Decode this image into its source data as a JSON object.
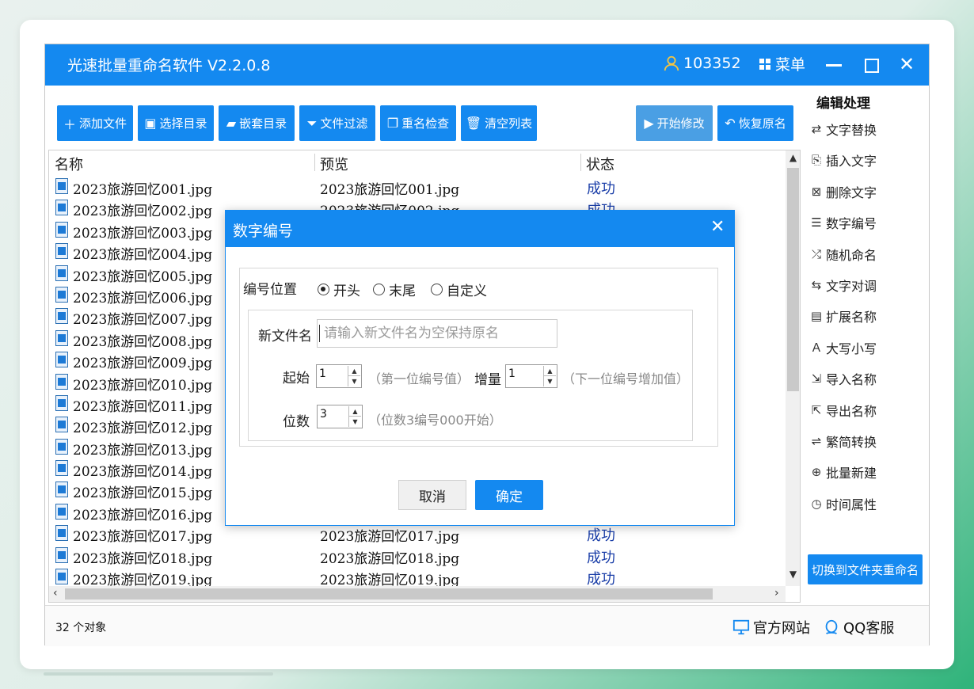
{
  "window": {
    "title": "光速批量重命名软件 V2.2.0.8",
    "user_id": "103352",
    "menu_label": "菜单",
    "close_symbol": "✕"
  },
  "toolbar": {
    "add_file": "添加文件",
    "select_dir": "选择目录",
    "nested_dir": "嵌套目录",
    "file_filter": "文件过滤",
    "rename_check": "重名检查",
    "clear_list": "清空列表",
    "start_modify": "开始修改",
    "restore_name": "恢复原名"
  },
  "list": {
    "headers": {
      "name": "名称",
      "preview": "预览",
      "status": "状态"
    },
    "rows": [
      {
        "name": "2023旅游回忆001.jpg",
        "preview": "2023旅游回忆001.jpg",
        "status": "成功"
      },
      {
        "name": "2023旅游回忆002.jpg",
        "preview": "2023旅游回忆002.jpg",
        "status": "成功"
      },
      {
        "name": "2023旅游回忆003.jpg",
        "preview": "",
        "status": ""
      },
      {
        "name": "2023旅游回忆004.jpg",
        "preview": "",
        "status": ""
      },
      {
        "name": "2023旅游回忆005.jpg",
        "preview": "",
        "status": ""
      },
      {
        "name": "2023旅游回忆006.jpg",
        "preview": "",
        "status": ""
      },
      {
        "name": "2023旅游回忆007.jpg",
        "preview": "",
        "status": ""
      },
      {
        "name": "2023旅游回忆008.jpg",
        "preview": "",
        "status": ""
      },
      {
        "name": "2023旅游回忆009.jpg",
        "preview": "",
        "status": ""
      },
      {
        "name": "2023旅游回忆010.jpg",
        "preview": "",
        "status": ""
      },
      {
        "name": "2023旅游回忆011.jpg",
        "preview": "",
        "status": ""
      },
      {
        "name": "2023旅游回忆012.jpg",
        "preview": "",
        "status": ""
      },
      {
        "name": "2023旅游回忆013.jpg",
        "preview": "",
        "status": ""
      },
      {
        "name": "2023旅游回忆014.jpg",
        "preview": "",
        "status": ""
      },
      {
        "name": "2023旅游回忆015.jpg",
        "preview": "",
        "status": ""
      },
      {
        "name": "2023旅游回忆016.jpg",
        "preview": "",
        "status": ""
      },
      {
        "name": "2023旅游回忆017.jpg",
        "preview": "2023旅游回忆017.jpg",
        "status": "成功"
      },
      {
        "name": "2023旅游回忆018.jpg",
        "preview": "2023旅游回忆018.jpg",
        "status": "成功"
      },
      {
        "name": "2023旅游回忆019.jpg",
        "preview": "2023旅游回忆019.jpg",
        "status": "成功"
      }
    ]
  },
  "sidebar": {
    "title": "编辑处理",
    "items": [
      {
        "label": "文字替换",
        "icon": "swap-arrows-icon",
        "glyph": "⇄"
      },
      {
        "label": "插入文字",
        "icon": "insert-doc-icon",
        "glyph": "⎘"
      },
      {
        "label": "删除文字",
        "icon": "delete-doc-icon",
        "glyph": "⊠"
      },
      {
        "label": "数字编号",
        "icon": "number-list-icon",
        "glyph": "☰"
      },
      {
        "label": "随机命名",
        "icon": "shuffle-icon",
        "glyph": "⤮"
      },
      {
        "label": "文字对调",
        "icon": "exchange-icon",
        "glyph": "⇆"
      },
      {
        "label": "扩展名称",
        "icon": "extension-icon",
        "glyph": "▤"
      },
      {
        "label": "大写小写",
        "icon": "case-icon",
        "glyph": "Ａ"
      },
      {
        "label": "导入名称",
        "icon": "import-icon",
        "glyph": "⇲"
      },
      {
        "label": "导出名称",
        "icon": "export-icon",
        "glyph": "⇱"
      },
      {
        "label": "繁简转换",
        "icon": "convert-icon",
        "glyph": "⇌"
      },
      {
        "label": "批量新建",
        "icon": "new-file-icon",
        "glyph": "⊕"
      },
      {
        "label": "时间属性",
        "icon": "clock-icon",
        "glyph": "◷"
      }
    ],
    "switch_button": "切换到文件夹重命名"
  },
  "status": {
    "count": "32 个对象",
    "website": "官方网站",
    "qq": "QQ客服"
  },
  "dialog": {
    "title": "数字编号",
    "position_label": "编号位置",
    "radio_start": "开头",
    "radio_end": "末尾",
    "radio_custom": "自定义",
    "selected_position": "开头",
    "new_name_label": "新文件名",
    "new_name_placeholder": "请输入新文件名为空保持原名",
    "start_label": "起始",
    "start_value": "1",
    "start_hint": "（第一位编号值）",
    "increment_label": "增量",
    "increment_value": "1",
    "increment_hint": "（下一位编号增加值）",
    "digits_label": "位数",
    "digits_value": "3",
    "digits_hint": "（位数3编号000开始）",
    "cancel": "取消",
    "ok": "确定"
  },
  "colors": {
    "accent": "#1489f0",
    "status_success": "#1a3ea8"
  }
}
